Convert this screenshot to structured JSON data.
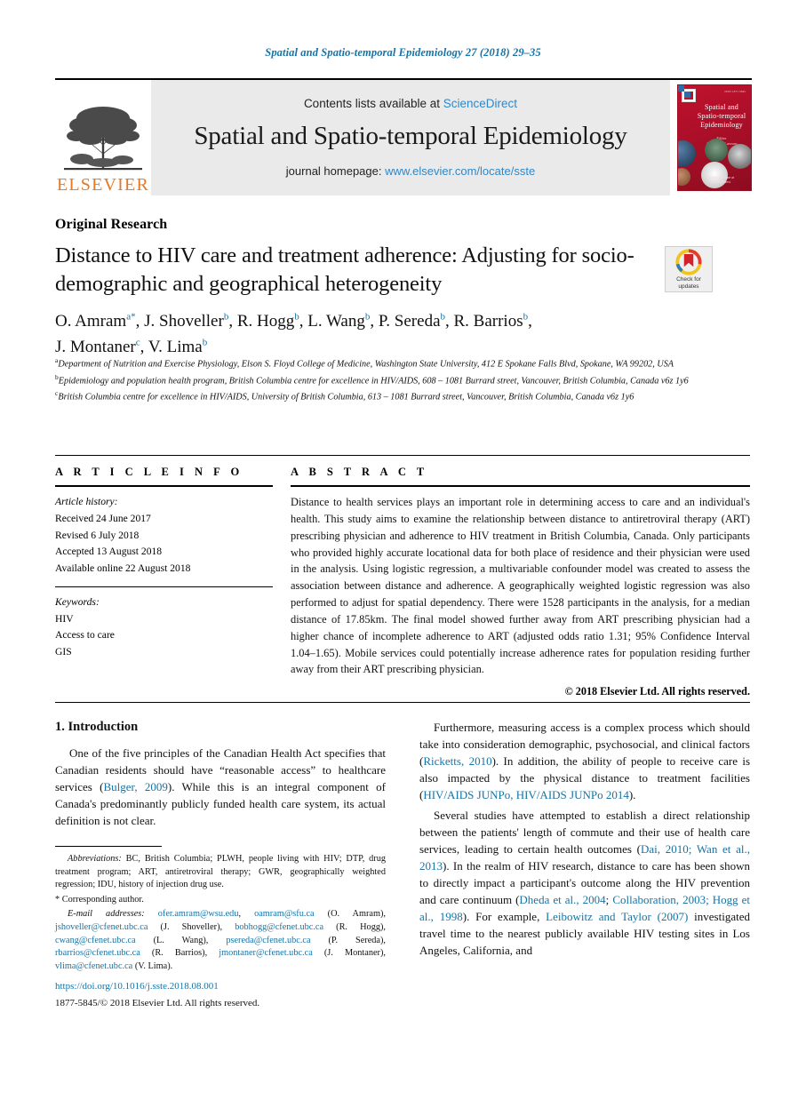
{
  "running_head": "Spatial and Spatio-temporal Epidemiology 27 (2018) 29–35",
  "masthead": {
    "publisher_wordmark": "ELSEVIER",
    "contents_prefix": "Contents lists available at ",
    "sciencedirect": "ScienceDirect",
    "journal_title": "Spatial and Spatio-temporal Epidemiology",
    "homepage_prefix": "journal homepage: ",
    "homepage_url": "www.elsevier.com/locate/sste",
    "cover": {
      "title_line1": "Spatial and",
      "title_line2": "Spatio-temporal",
      "title_line3": "Epidemiology",
      "editor_label": "Editor",
      "editor_name": "Andrew B. Lawson",
      "corner_label": "ISSN 1877-5845",
      "footer_line1": "Available online at",
      "footer_line2": "ScienceDirect"
    }
  },
  "article": {
    "type": "Original Research",
    "title_line1": "Distance to HIV care and treatment adherence: Adjusting for",
    "title_line2": "socio-demographic and geographical heterogeneity",
    "crossmark_line1": "Check for",
    "crossmark_line2": "updates"
  },
  "authors": [
    {
      "name": "O. Amram",
      "sup": "a",
      "corresponding": true
    },
    {
      "name": "J. Shoveller",
      "sup": "b"
    },
    {
      "name": "R. Hogg",
      "sup": "b"
    },
    {
      "name": "L. Wang",
      "sup": "b"
    },
    {
      "name": "P. Sereda",
      "sup": "b"
    },
    {
      "name": "R. Barrios",
      "sup": "b"
    },
    {
      "name": "J. Montaner",
      "sup": "c"
    },
    {
      "name": "V. Lima",
      "sup": "b"
    }
  ],
  "affiliations": [
    {
      "marker": "a",
      "text": "Department of Nutrition and Exercise Physiology, Elson S. Floyd College of Medicine, Washington State University, 412 E Spokane Falls Blvd, Spokane, WA 99202, USA"
    },
    {
      "marker": "b",
      "text": "Epidemiology and population health program, British Columbia centre for excellence in HIV/AIDS, 608 – 1081 Burrard street, Vancouver, British Columbia, Canada v6z 1y6"
    },
    {
      "marker": "c",
      "text": "British Columbia centre for excellence in HIV/AIDS, University of British Columbia, 613 – 1081 Burrard street, Vancouver, British Columbia, Canada v6z 1y6"
    }
  ],
  "article_info": {
    "heading": "A R T I C L E  I N F O",
    "history_label": "Article history:",
    "history": [
      "Received 24 June 2017",
      "Revised 6 July 2018",
      "Accepted 13 August 2018",
      "Available online 22 August 2018"
    ],
    "keywords_label": "Keywords:",
    "keywords": [
      "HIV",
      "Access to care",
      "GIS"
    ]
  },
  "abstract": {
    "heading": "A B S T R A C T",
    "text": "Distance to health services plays an important role in determining access to care and an individual's health. This study aims to examine the relationship between distance to antiretroviral therapy (ART) prescribing physician and adherence to HIV treatment in British Columbia, Canada. Only participants who provided highly accurate locational data for both place of residence and their physician were used in the analysis. Using logistic regression, a multivariable confounder model was created to assess the association between distance and adherence. A geographically weighted logistic regression was also performed to adjust for spatial dependency. There were 1528 participants in the analysis, for a median distance of 17.85km. The final model showed further away from ART prescribing physician had a higher chance of incomplete adherence to ART (adjusted odds ratio 1.31; 95% Confidence Interval 1.04–1.65). Mobile services could potentially increase adherence rates for population residing further away from their ART prescribing physician.",
    "copyright": "© 2018 Elsevier Ltd. All rights reserved."
  },
  "body": {
    "section_heading": "1. Introduction",
    "left_paragraph_1_a": "One of the five principles of the Canadian Health Act specifies that Canadian residents should have “reasonable access” to healthcare services (",
    "left_paragraph_1_cite": "Bulger, 2009",
    "left_paragraph_1_b": "). While this is an integral component of Canada's predominantly publicly funded health care system, its actual definition is not clear.",
    "right_paragraph_1_a": "Furthermore, measuring access is a complex process which should take into consideration demographic, psychosocial, and clinical factors (",
    "right_paragraph_1_cite1": "Ricketts, 2010",
    "right_paragraph_1_b": "). In addition, the ability of people to receive care is also impacted by the physical distance to treatment facilities (",
    "right_paragraph_1_cite2": "HIV/AIDS JUNPo, HIV/AIDS JUNPo 2014",
    "right_paragraph_1_c": ").",
    "right_paragraph_2_a": "Several studies have attempted to establish a direct relationship between the patients' length of commute and their use of health care services, leading to certain health outcomes (",
    "right_paragraph_2_cite1": "Dai, 2010; Wan et al., 2013",
    "right_paragraph_2_b": "). In the realm of HIV research, distance to care has been shown to directly impact a participant's outcome along the HIV prevention and care continuum (",
    "right_paragraph_2_cite2": "Dheda et al., 2004",
    "right_paragraph_2_c": "; ",
    "right_paragraph_2_cite3": "Collaboration, 2003; Hogg et al., 1998",
    "right_paragraph_2_d": "). For example, ",
    "right_paragraph_2_cite4": "Leibowitz and Taylor (2007)",
    "right_paragraph_2_e": " investigated travel time to the nearest publicly available HIV testing sites in Los Angeles, California, and"
  },
  "footnotes": {
    "abbreviations_label": "Abbreviations:",
    "abbreviations_text": " BC, British Columbia; PLWH, people living with HIV; DTP, drug treatment program; ART, antiretroviral therapy; GWR, geographically weighted regression; IDU, history of injection drug use.",
    "corresponding_marker": "*",
    "corresponding_text": " Corresponding author.",
    "email_label": "E-mail addresses:",
    "emails": [
      {
        "address": "ofer.amram@wsu.edu",
        "sep": ", "
      },
      {
        "address": "oamram@sfu.ca",
        "sep": " (O. Amram), "
      },
      {
        "address": "jshoveller@cfenet.ubc.ca",
        "sep": " (J. Shoveller), "
      },
      {
        "address": "bobhogg@cfenet.ubc.ca",
        "sep": " (R. Hogg), "
      },
      {
        "address": "cwang@cfenet.ubc.ca",
        "sep": " (L. Wang), "
      },
      {
        "address": "psereda@cfenet.ubc.ca",
        "sep": " (P. Sereda), "
      },
      {
        "address": "rbarrios@cfenet.ubc.ca",
        "sep": " (R. Barrios), "
      },
      {
        "address": "jmontaner@cfenet.ubc.ca",
        "sep": " (J. Montaner), "
      },
      {
        "address": "vlima@cfenet.ubc.ca",
        "sep": " (V. Lima)."
      }
    ]
  },
  "footer": {
    "doi": "https://doi.org/10.1016/j.sste.2018.08.001",
    "issn_line": "1877-5845/© 2018 Elsevier Ltd. All rights reserved."
  },
  "colors": {
    "link_blue": "#1673a6",
    "banner_gray": "#eaeaea",
    "elsevier_orange": "#E87722",
    "cover_red": "#b5132c"
  }
}
